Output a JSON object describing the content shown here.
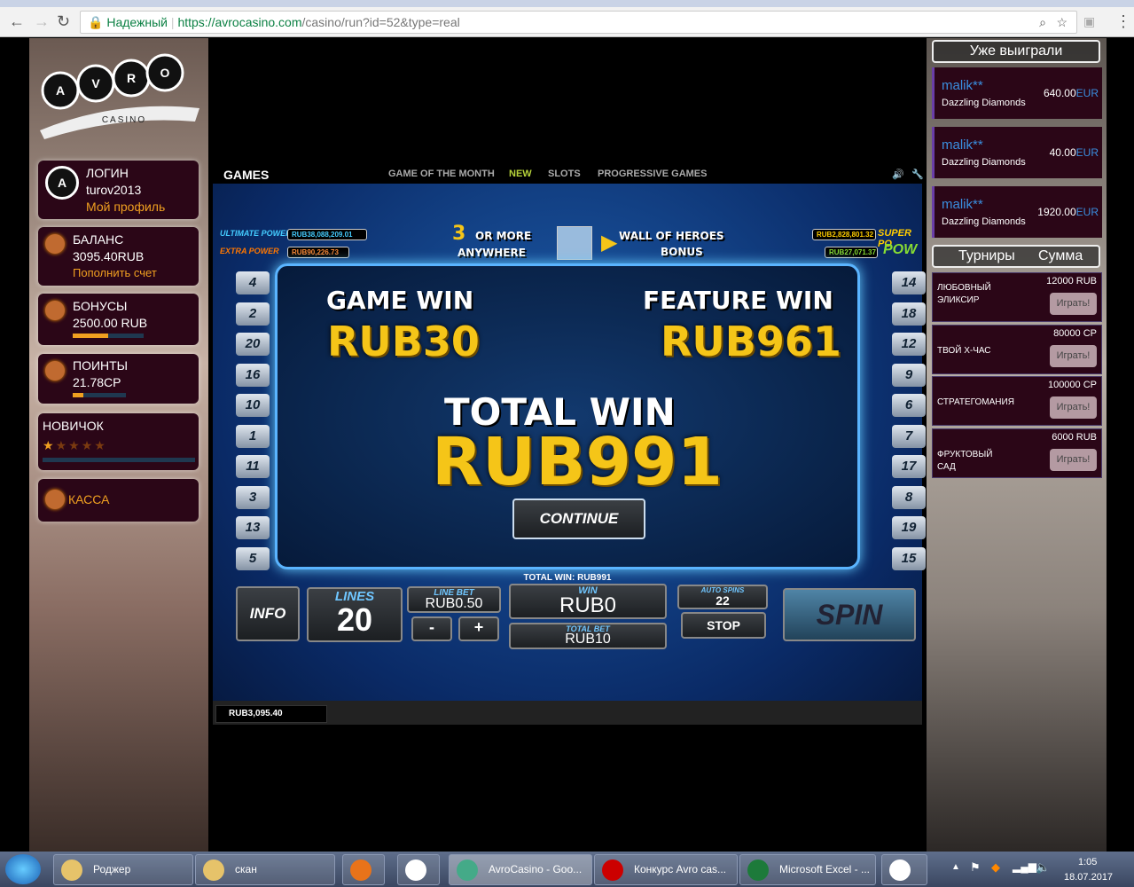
{
  "browser": {
    "secure_label": "Надежный",
    "url_host": "https://avrocasino.com",
    "url_path": "/casino/run?id=52&type=real"
  },
  "logo": {
    "text": "CASINO",
    "letters": [
      "A",
      "V",
      "R",
      "O"
    ]
  },
  "left": {
    "login": {
      "title": "ЛОГИН",
      "username": "turov2013",
      "profile_link": "Мой профиль"
    },
    "balance": {
      "title": "БАЛАНС",
      "value": "3095.40RUB",
      "deposit_link": "Пополнить счет"
    },
    "bonus": {
      "title": "БОНУСЫ",
      "value": "2500.00 RUB",
      "progress": 0.5
    },
    "points": {
      "title": "ПОИНТЫ",
      "value": "21.78CP",
      "progress": 0.2
    },
    "level": {
      "title": "НОВИЧОК",
      "stars_total": 5,
      "stars_filled": 1
    },
    "cashier": {
      "label": "КАССА"
    }
  },
  "game": {
    "nav": {
      "title": "GAMES",
      "items": [
        "GAME OF THE MONTH",
        "NEW",
        "SLOTS",
        "PROGRESSIVE GAMES"
      ],
      "active": "NEW"
    },
    "jackpots": {
      "ultimate_power": "RUB38,088,209.01",
      "extra_power": "RUB90,226.73",
      "super_power": "RUB2,828,801.32",
      "power": "RUB27,071.37"
    },
    "bonus_banner": {
      "line1a": "3",
      "line1b": "OR MORE",
      "line2": "ANYWHERE",
      "target1": "WALL OF HEROES",
      "target2": "BONUS"
    },
    "game_win_label": "GAME WIN",
    "game_win": "RUB30",
    "feature_win_label": "FEATURE WIN",
    "feature_win": "RUB961",
    "total_win_label": "TOTAL WIN",
    "total_win": "RUB991",
    "continue_label": "CONTINUE",
    "left_lines": [
      "4",
      "2",
      "20",
      "16",
      "10",
      "1",
      "11",
      "3",
      "13",
      "5"
    ],
    "right_lines": [
      "14",
      "18",
      "12",
      "9",
      "6",
      "7",
      "17",
      "8",
      "19",
      "15"
    ],
    "total_win_strip": "TOTAL WIN: RUB991",
    "controls": {
      "info": "INFO",
      "lines_label": "LINES",
      "lines": "20",
      "line_bet_label": "LINE BET",
      "line_bet": "RUB0.50",
      "minus": "-",
      "plus": "+",
      "win_label": "WIN",
      "win": "RUB0",
      "total_bet_label": "TOTAL BET",
      "total_bet": "RUB10",
      "auto_spins_label": "AUTO SPINS",
      "auto_spins": "22",
      "stop": "STOP",
      "spin": "SPIN"
    },
    "balance": "RUB3,095.40"
  },
  "right": {
    "winners_title": "Уже выиграли",
    "winners": [
      {
        "user": "malik**",
        "game": "Dazzling Diamonds",
        "amount": "640.00",
        "currency": "EUR"
      },
      {
        "user": "malik**",
        "game": "Dazzling Diamonds",
        "amount": "40.00",
        "currency": "EUR"
      },
      {
        "user": "malik**",
        "game": "Dazzling Diamonds",
        "amount": "1920.00",
        "currency": "EUR"
      }
    ],
    "tournaments_title": "Турниры",
    "sum_title": "Сумма",
    "tournaments": [
      {
        "name": "ЛЮБОВНЫЙ ЭЛИКСИР",
        "prize": "12000 RUB",
        "button": "Играть!"
      },
      {
        "name": "ТВОЙ Х-ЧАС",
        "prize": "80000 CP",
        "button": "Играть!"
      },
      {
        "name": "СТРАТЕГОМАНИЯ",
        "prize": "100000 CP",
        "button": "Играть!"
      },
      {
        "name": "ФРУКТОВЫЙ САД",
        "prize": "6000 RUB",
        "button": "Играть!"
      }
    ]
  },
  "taskbar": {
    "items": [
      "Роджер",
      "скан",
      "",
      "",
      "AvroCasino - Goo...",
      "Конкурс Avro cas...",
      "Microsoft Excel - ...",
      ""
    ],
    "time": "1:05",
    "date": "18.07.2017"
  }
}
